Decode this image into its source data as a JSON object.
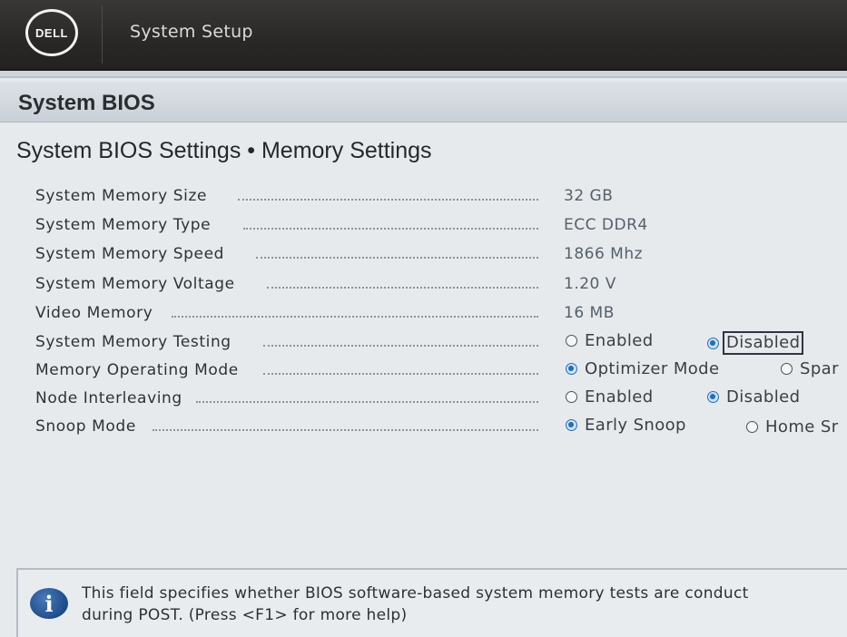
{
  "header": {
    "logo_text": "DELL",
    "app_title": "System Setup"
  },
  "section": {
    "title": "System BIOS"
  },
  "page": {
    "title": "System BIOS Settings • Memory Settings"
  },
  "settings": [
    {
      "label": "System Memory Size",
      "value": "32 GB"
    },
    {
      "label": "System Memory Type",
      "value": "ECC DDR4"
    },
    {
      "label": "System Memory Speed",
      "value": "1866 Mhz"
    },
    {
      "label": "System Memory Voltage",
      "value": "1.20 V"
    },
    {
      "label": "Video Memory",
      "value": "16 MB"
    },
    {
      "label": "System Memory Testing",
      "options": [
        {
          "label": "Enabled",
          "selected": false
        },
        {
          "label": "Disabled",
          "selected": true
        }
      ]
    },
    {
      "label": "Memory Operating Mode",
      "options": [
        {
          "label": "Optimizer Mode",
          "selected": true
        },
        {
          "label": "Spar",
          "selected": false
        }
      ]
    },
    {
      "label": "Node Interleaving",
      "options": [
        {
          "label": "Enabled",
          "selected": false
        },
        {
          "label": "Disabled",
          "selected": true
        }
      ]
    },
    {
      "label": "Snoop Mode",
      "options": [
        {
          "label": "Early Snoop",
          "selected": true
        },
        {
          "label": "Home Sr",
          "selected": false
        }
      ]
    }
  ],
  "help": {
    "icon": "info-icon",
    "line1": "This field specifies whether BIOS software-based system memory tests are conduct",
    "line2": "during POST. (Press <F1> for more help)"
  },
  "colors": {
    "header_bg": "#2a2826",
    "panel_bg": "#e7eaed",
    "radio_selected": "#1f6fbf",
    "info_icon": "#1d4c8d"
  }
}
